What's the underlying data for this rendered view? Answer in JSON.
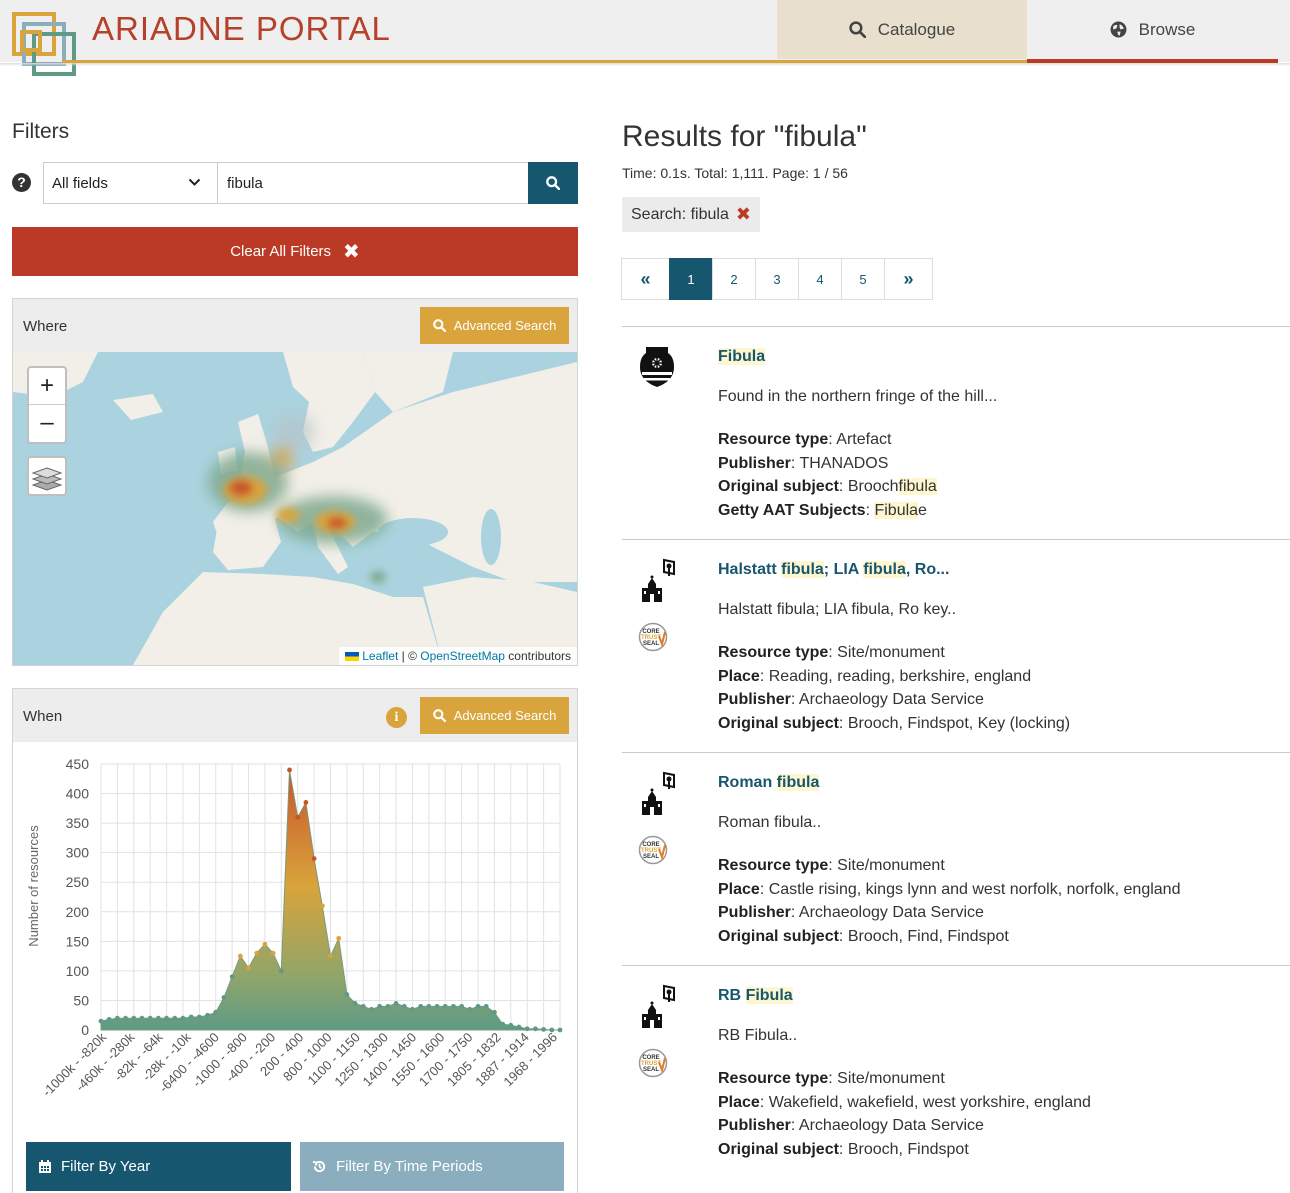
{
  "header": {
    "brand": "ARIADNE PORTAL",
    "nav": [
      {
        "label": "Catalogue",
        "icon": "search-icon",
        "active": true
      },
      {
        "label": "Browse",
        "icon": "globe-icon",
        "active": false
      }
    ]
  },
  "filters": {
    "title": "Filters",
    "field_select": "All fields",
    "search_value": "fibula",
    "clear_label": "Clear All Filters"
  },
  "where": {
    "label": "Where",
    "advanced_label": "Advanced Search",
    "zoom_in": "+",
    "zoom_out": "–",
    "attribution": {
      "leaflet": "Leaflet",
      "sep": " | © ",
      "osm": "OpenStreetMap",
      "tail": " contributors"
    }
  },
  "when": {
    "label": "When",
    "info": "i",
    "advanced_label": "Advanced Search",
    "tab_year": "Filter By Year",
    "tab_periods": "Filter By Time Periods"
  },
  "chart_data": {
    "type": "area",
    "ylabel": "Number of resources",
    "yticks": [
      0,
      50,
      100,
      150,
      200,
      250,
      300,
      350,
      400,
      450
    ],
    "ylim": [
      0,
      450
    ],
    "xtick_labels": [
      "-1000k - -820k",
      "-460k - -280k",
      "-82k - -64k",
      "-28k - -10k",
      "-6400 - -4600",
      "-1000 - -800",
      "-400 - -200",
      "200 - 400",
      "800 - 1000",
      "1100 - 1150",
      "1250 - 1300",
      "1400 - 1450",
      "1550 - 1600",
      "1700 - 1750",
      "1805 - 1832",
      "1887 - 1914",
      "1968 - 1996"
    ],
    "values": [
      15,
      18,
      20,
      20,
      20,
      20,
      20,
      20,
      20,
      20,
      20,
      22,
      22,
      25,
      30,
      55,
      90,
      125,
      105,
      130,
      145,
      130,
      100,
      440,
      360,
      385,
      290,
      210,
      125,
      155,
      60,
      45,
      40,
      35,
      40,
      40,
      45,
      40,
      35,
      40,
      40,
      40,
      40,
      40,
      40,
      35,
      40,
      40,
      30,
      10,
      8,
      5,
      2,
      2,
      1,
      0,
      0
    ],
    "grid": true,
    "colors": {
      "low": "#5e9a86",
      "mid": "#d9a43c",
      "high": "#c8542c"
    }
  },
  "results": {
    "title": "Results for \"fibula\"",
    "meta": "Time: 0.1s. Total: 1,111. Page: 1 / 56",
    "chip": "Search: fibula",
    "chip_remove": "✖",
    "pages": [
      "«",
      "1",
      "2",
      "3",
      "4",
      "5",
      "»"
    ],
    "items": [
      {
        "title": "Fibula",
        "description": "Found in the northern fringe of the hill...",
        "icon": "artefact-icon",
        "seal": false,
        "props": [
          {
            "k": "Resource type",
            "v": "Artefact"
          },
          {
            "k": "Publisher",
            "v": "THANADOS"
          },
          {
            "k": "Original subject",
            "v": "Broochfibula"
          },
          {
            "k": "Getty AAT Subjects",
            "v": "Fibulae"
          }
        ]
      },
      {
        "title": "Halstatt fibula; LIA fibula, Ro...",
        "description": "Halstatt fibula; LIA fibula, Ro key..",
        "icon": "site-monument-icon",
        "seal": true,
        "props": [
          {
            "k": "Resource type",
            "v": "Site/monument"
          },
          {
            "k": "Place",
            "v": "Reading, reading, berkshire, england"
          },
          {
            "k": "Publisher",
            "v": "Archaeology Data Service"
          },
          {
            "k": "Original subject",
            "v": "Brooch, Findspot, Key (locking)"
          }
        ]
      },
      {
        "title": "Roman fibula",
        "description": "Roman fibula..",
        "icon": "site-monument-icon",
        "seal": true,
        "props": [
          {
            "k": "Resource type",
            "v": "Site/monument"
          },
          {
            "k": "Place",
            "v": "Castle rising, kings lynn and west norfolk, norfolk, england"
          },
          {
            "k": "Publisher",
            "v": "Archaeology Data Service"
          },
          {
            "k": "Original subject",
            "v": "Brooch, Find, Findspot"
          }
        ]
      },
      {
        "title": "RB Fibula",
        "description": "RB Fibula..",
        "icon": "site-monument-icon",
        "seal": true,
        "props": [
          {
            "k": "Resource type",
            "v": "Site/monument"
          },
          {
            "k": "Place",
            "v": "Wakefield, wakefield, west yorkshire, england"
          },
          {
            "k": "Publisher",
            "v": "Archaeology Data Service"
          },
          {
            "k": "Original subject",
            "v": "Brooch, Findspot"
          }
        ]
      }
    ],
    "seal_text": "CORE TRUST SEAL"
  }
}
